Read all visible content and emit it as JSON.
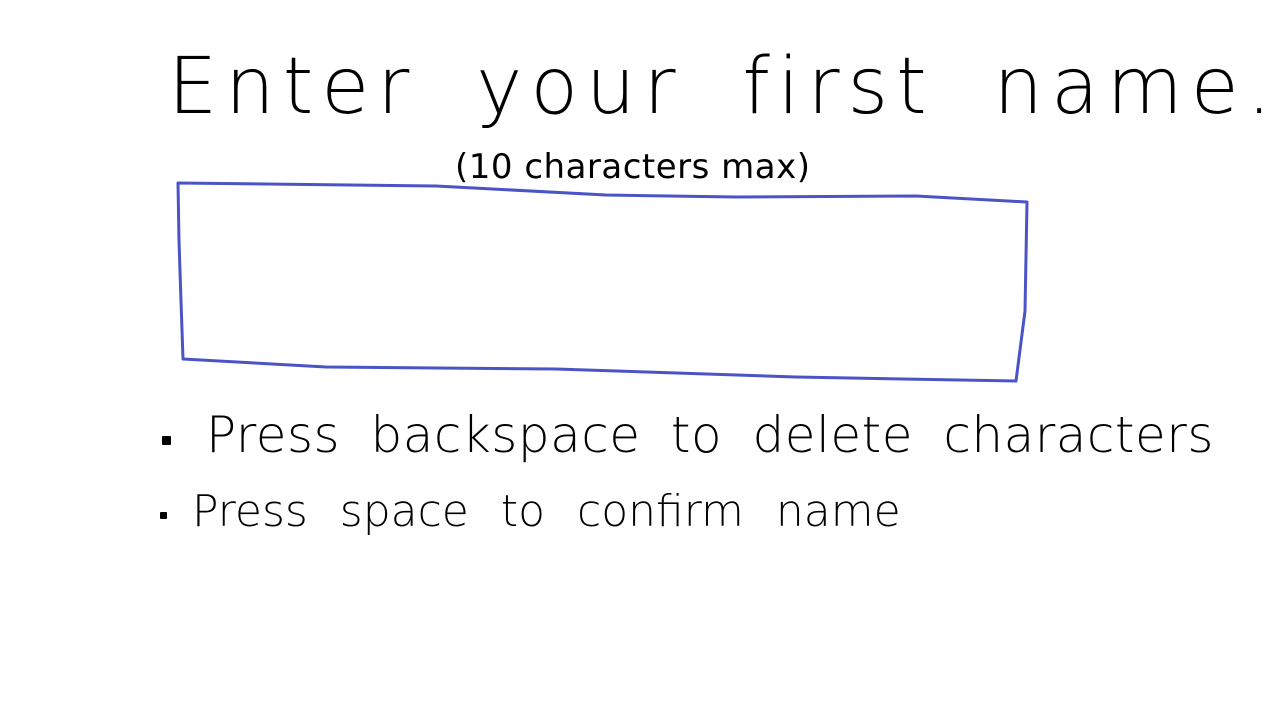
{
  "prompt": {
    "title": "Enter your first name.",
    "subtitle": "(10 characters max)"
  },
  "name_field": {
    "value": "",
    "border_color": "#4a54c7"
  },
  "instructions": [
    {
      "text": "Press backspace to delete characters"
    },
    {
      "text": "Press space to confirm name"
    }
  ]
}
